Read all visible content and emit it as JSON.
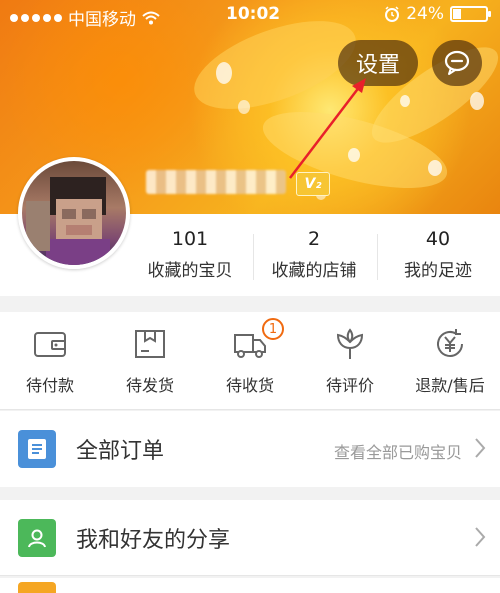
{
  "status_bar": {
    "carrier": "中国移动",
    "time": "10:02",
    "battery_percent": "24%",
    "battery_level": 0.24
  },
  "header": {
    "settings_label": "设置",
    "vip_badge": "V₂"
  },
  "stats": [
    {
      "value": "101",
      "label": "收藏的宝贝"
    },
    {
      "value": "2",
      "label": "收藏的店铺"
    },
    {
      "value": "40",
      "label": "我的足迹"
    }
  ],
  "orders": [
    {
      "label": "待付款",
      "icon": "wallet-icon"
    },
    {
      "label": "待发货",
      "icon": "package-icon"
    },
    {
      "label": "待收货",
      "icon": "truck-icon",
      "badge": "1"
    },
    {
      "label": "待评价",
      "icon": "flower-icon"
    },
    {
      "label": "退款/售后",
      "icon": "refund-yen-icon"
    }
  ],
  "all_orders": {
    "title": "全部订单",
    "hint": "查看全部已购宝贝"
  },
  "share": {
    "title": "我和好友的分享"
  },
  "colors": {
    "accent_orange": "#f06a10",
    "order_list_icon": "#4a90d9",
    "share_icon": "#4cb85a",
    "arrow_annotation": "#e8202a"
  }
}
